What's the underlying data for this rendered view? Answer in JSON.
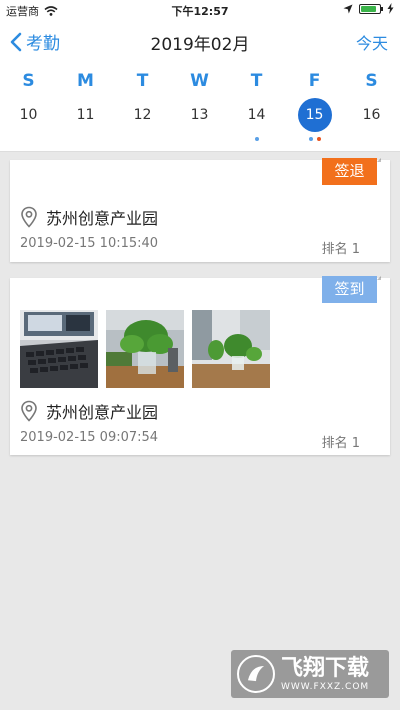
{
  "status_bar": {
    "carrier": "运营商",
    "time": "下午12:57",
    "icons": [
      "wifi-icon",
      "location-arrow-icon",
      "battery-icon",
      "charging-icon"
    ]
  },
  "nav": {
    "back_label": "考勤",
    "title": "2019年02月",
    "today_label": "今天"
  },
  "week": {
    "days": [
      {
        "dow": "S",
        "num": "10",
        "dots": []
      },
      {
        "dow": "M",
        "num": "11",
        "dots": []
      },
      {
        "dow": "T",
        "num": "12",
        "dots": []
      },
      {
        "dow": "W",
        "num": "13",
        "dots": []
      },
      {
        "dow": "T",
        "num": "14",
        "dots": [
          "#5aa0e6"
        ]
      },
      {
        "dow": "F",
        "num": "15",
        "dots": [
          "#5aa0e6",
          "#e8541e"
        ],
        "selected": true
      },
      {
        "dow": "S",
        "num": "16",
        "dots": []
      }
    ]
  },
  "records": [
    {
      "badge": "签退",
      "badge_color": "#f2701c",
      "location": "苏州创意产业园",
      "time": "2019-02-15 10:15:40",
      "rank": "排名 1"
    },
    {
      "badge": "签到",
      "badge_color": "#7fb0ea",
      "location": "苏州创意产业园",
      "time": "2019-02-15 09:07:54",
      "rank": "排名 1",
      "photos": [
        "laptop-photo",
        "plant-photo",
        "office-plant-photo"
      ]
    }
  ],
  "colors": {
    "accent": "#2c8be0",
    "selected_day": "#1f6fd3",
    "background": "#e8e8e8"
  },
  "watermark": {
    "title": "飞翔下载",
    "url": "WWW.FXXZ.COM"
  }
}
